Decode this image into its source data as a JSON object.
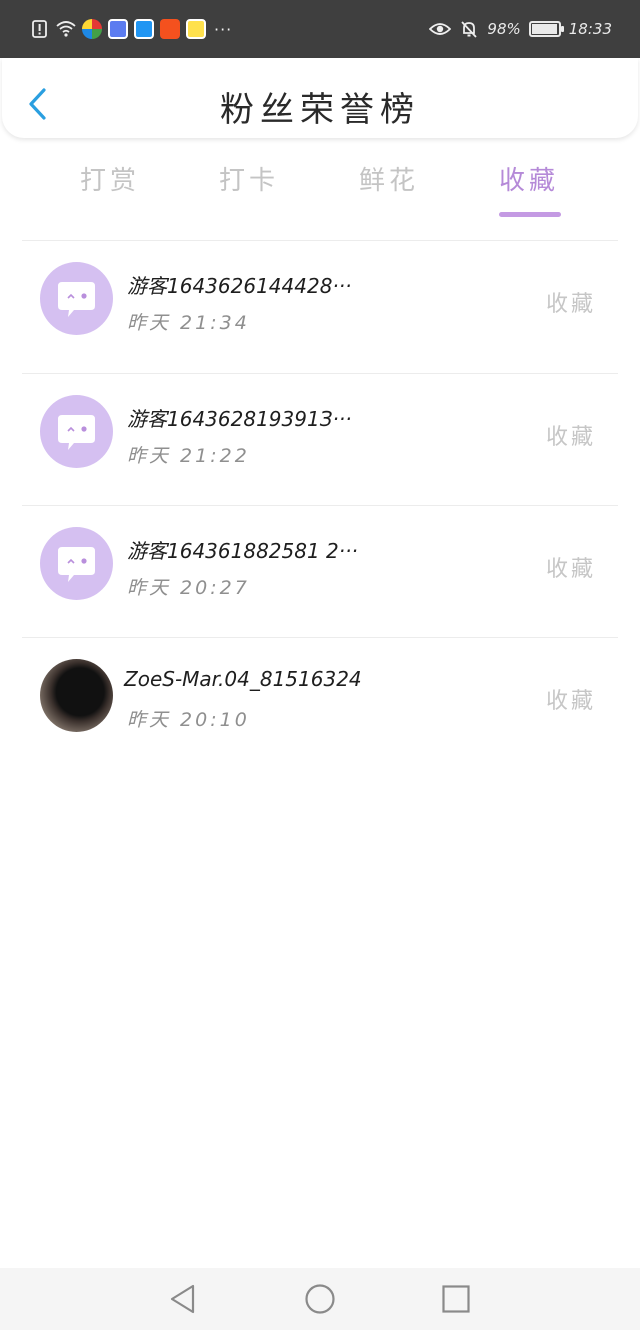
{
  "status_bar": {
    "battery": "98%",
    "time": "18:33",
    "battery_level": 0.98,
    "icons": [
      "alert-icon",
      "wifi-icon",
      "app-1-icon",
      "app-2-icon",
      "app-3-icon",
      "app-4-icon",
      "app-5-icon"
    ],
    "more": "···"
  },
  "header": {
    "title": "粉丝荣誉榜",
    "back_icon": "chevron-left-icon"
  },
  "tabs": [
    {
      "label": "打赏"
    },
    {
      "label": "打卡"
    },
    {
      "label": "鲜花"
    },
    {
      "label": "收藏"
    }
  ],
  "active_tab": "收藏",
  "fans": [
    {
      "name": "游客1643626144428···",
      "time": "昨天 21:34",
      "action": "收藏",
      "avatar": "guest-avatar"
    },
    {
      "name": "游客164362819391З···",
      "time": "昨天 21:22",
      "action": "收藏",
      "avatar": "guest-avatar"
    },
    {
      "name": "游客164361882581 2···",
      "time": "昨天 20:27",
      "action": "收藏",
      "avatar": "guest-avatar"
    },
    {
      "name": "ZoeS-Mar.04_81516324",
      "time": "昨天 20:10",
      "action": "收藏",
      "avatar": "photo-avatar"
    }
  ],
  "colors": {
    "accent": "#b58ad8",
    "status_bar_bg": "#3f3f3f",
    "avatar_bg": "#d5c0f1",
    "back_arrow": "#2a9fe0"
  },
  "nav": [
    "back-nav-icon",
    "home-nav-icon",
    "recents-nav-icon"
  ]
}
